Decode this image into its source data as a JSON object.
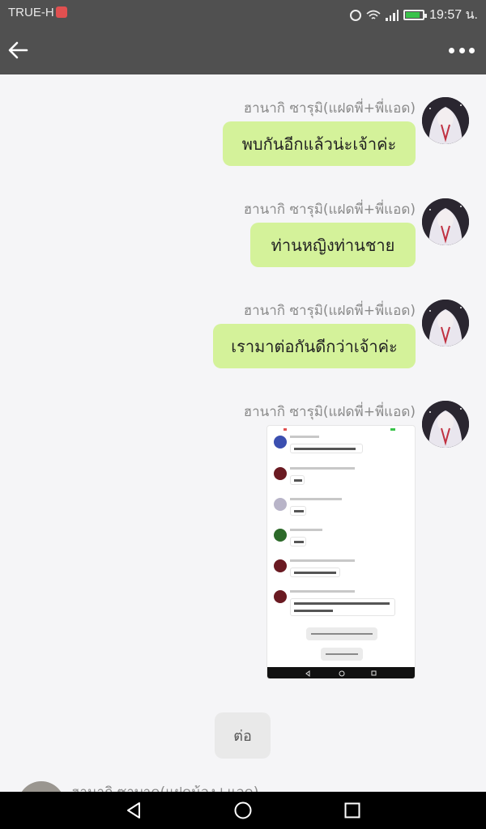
{
  "status_bar": {
    "carrier": "TRUE-H",
    "time": "19:57 น.",
    "icons": [
      "alarm-icon",
      "wifi-icon",
      "signal-icon",
      "battery-icon"
    ],
    "battery_color": "#39c24a"
  },
  "app_bar": {
    "back_icon": "arrow-left-icon",
    "menu_icon": "more-horizontal-icon",
    "background": "#505050"
  },
  "messages": [
    {
      "sender": "ฮานากิ ซารุมิ(แฝดพี่+พี่แอด)",
      "text": "พบกันอีกแล้วน่ะเจ้าค่ะ"
    },
    {
      "sender": "ฮานากิ ซารุมิ(แฝดพี่+พี่แอด)",
      "text": "ท่านหญิงท่านชาย"
    },
    {
      "sender": "ฮานากิ ซารุมิ(แฝดพี่+พี่แอด)",
      "text": "เรามาต่อกันดีกว่าเจ้าค่ะ"
    },
    {
      "sender": "ฮานากิ ซารุมิ(แฝดพี่+พี่แอด)",
      "text": ""
    }
  ],
  "bubble_color": "#d4f29a",
  "system_message": "ต่อ",
  "partial_message": {
    "sender": "ฮานากิ ซาบาค(แฝดน้อง+แอด)"
  },
  "nav_bar": {
    "icons": [
      "back-triangle-icon",
      "home-circle-icon",
      "recents-square-icon"
    ]
  }
}
